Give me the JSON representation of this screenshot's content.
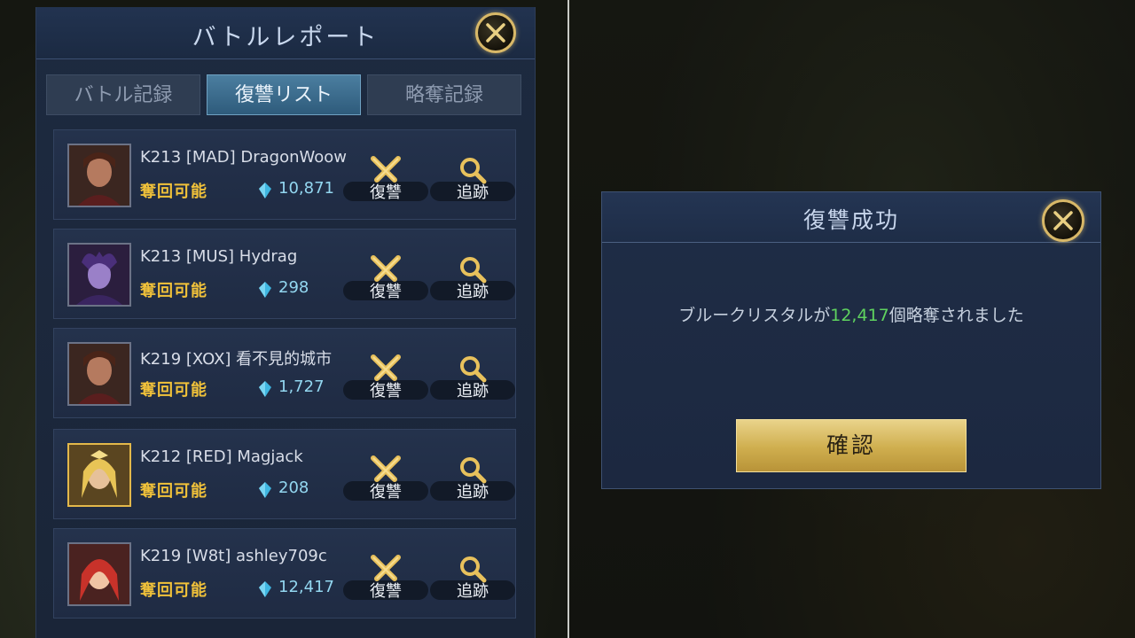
{
  "left": {
    "title": "バトルレポート",
    "tabs": [
      {
        "label": "バトル記録",
        "active": false
      },
      {
        "label": "復讐リスト",
        "active": true
      },
      {
        "label": "略奪記録",
        "active": false
      }
    ],
    "rows": [
      {
        "name": "K213 [MAD] DragonWoow",
        "status": "奪回可能",
        "amount": "10,871",
        "avatar": "male-portrait-icon"
      },
      {
        "name": "K213 [MUS] Hydrag",
        "status": "奪回可能",
        "amount": "298",
        "avatar": "horned-sorceress-portrait-icon"
      },
      {
        "name": "K219 [XOX] 看不見的城市",
        "status": "奪回可能",
        "amount": "1,727",
        "avatar": "male-portrait-icon"
      },
      {
        "name": "K212 [RED] Magjack",
        "status": "奪回可能",
        "amount": "208",
        "avatar": "blonde-heroine-portrait-icon"
      },
      {
        "name": "K219 [W8t] ashley709c",
        "status": "奪回可能",
        "amount": "12,417",
        "avatar": "red-haired-girl-portrait-icon"
      }
    ],
    "actions": {
      "revenge": "復讐",
      "track": "追跡"
    }
  },
  "dialog": {
    "title": "復讐成功",
    "message_prefix": "ブルークリスタルが",
    "message_value": "12,417",
    "message_suffix": "個略奪されました",
    "confirm": "確認"
  },
  "colors": {
    "status": "#f1c23a",
    "crystal": "#93d7f0",
    "highlight": "#5fd35f",
    "accent_gold": "#d8b868"
  }
}
